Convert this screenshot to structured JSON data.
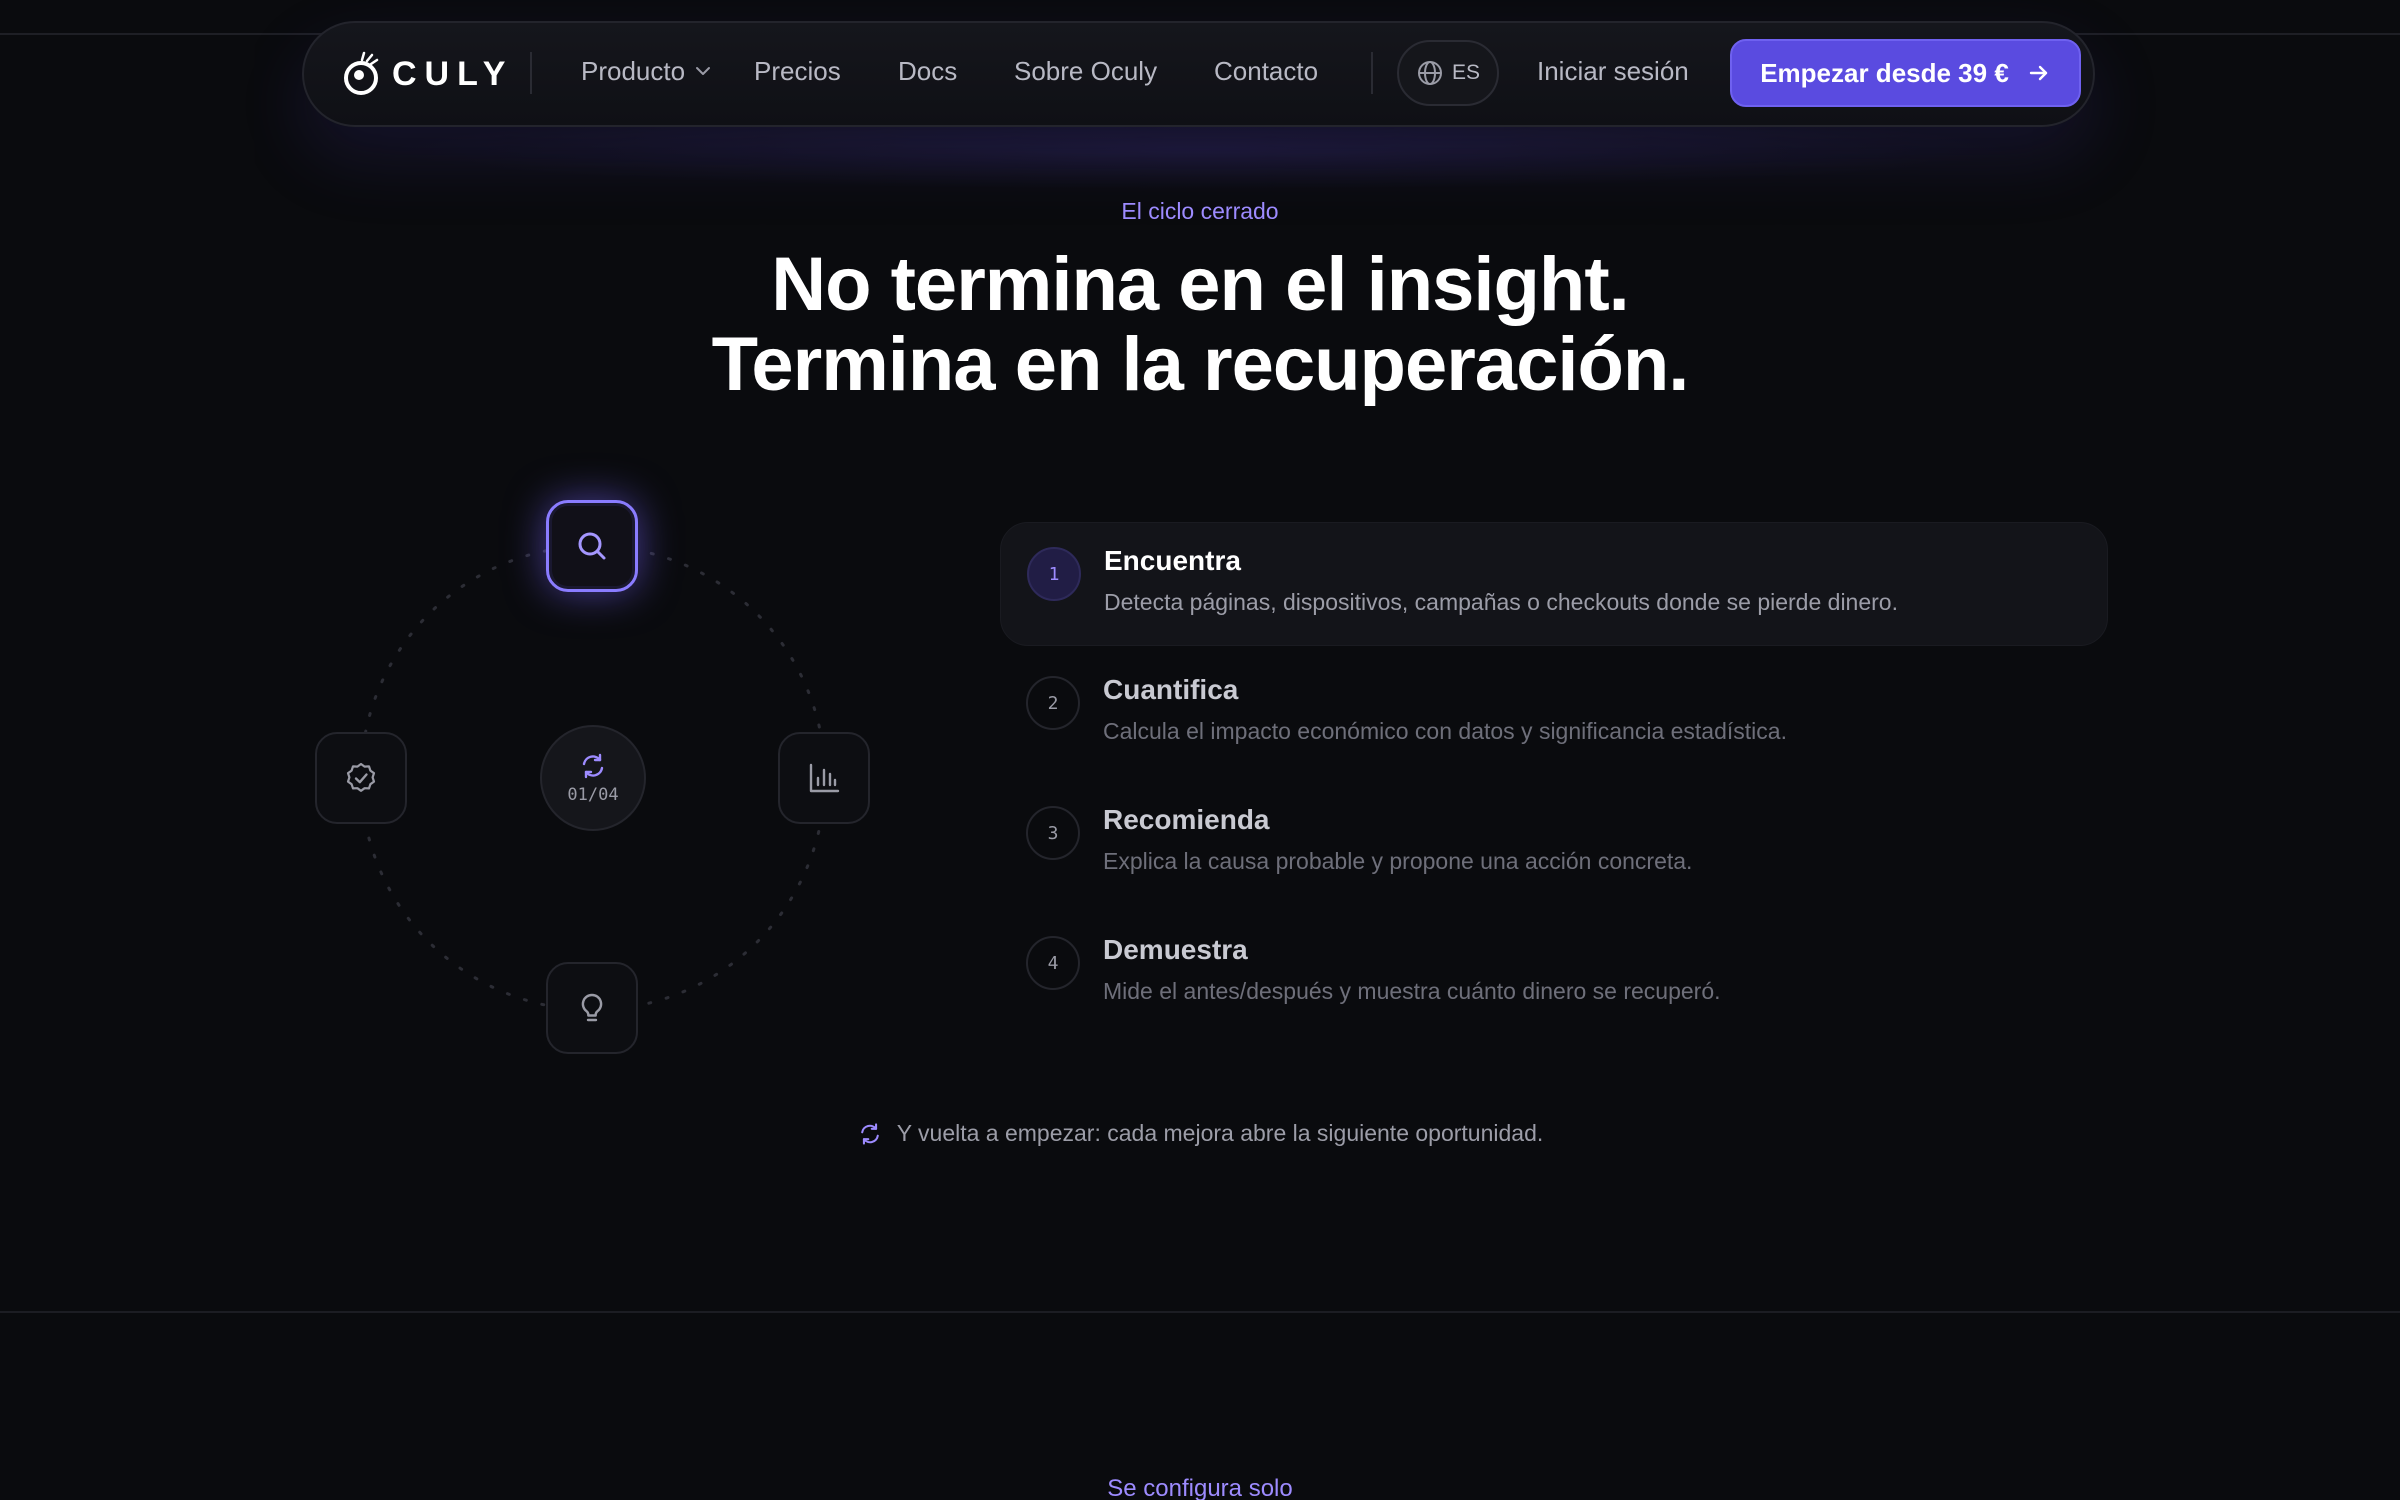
{
  "brand": {
    "name": "CULY"
  },
  "nav": {
    "links": [
      {
        "label": "Producto",
        "has_dropdown": true
      },
      {
        "label": "Precios"
      },
      {
        "label": "Docs"
      },
      {
        "label": "Sobre Oculy"
      },
      {
        "label": "Contacto"
      }
    ],
    "language": "ES",
    "login": "Iniciar sesión",
    "cta": "Empezar desde 39 €"
  },
  "hero": {
    "eyebrow": "El ciclo cerrado",
    "title_line1": "No termina en el insight.",
    "title_line2": "Termina en la recuperación."
  },
  "cycle": {
    "counter": "01/04",
    "nodes": [
      {
        "icon": "search-icon",
        "active": true
      },
      {
        "icon": "bar-chart-icon",
        "active": false
      },
      {
        "icon": "lightbulb-icon",
        "active": false
      },
      {
        "icon": "badge-check-icon",
        "active": false
      }
    ]
  },
  "steps": [
    {
      "num": "1",
      "title": "Encuentra",
      "desc": "Detecta páginas, dispositivos, campañas o checkouts donde se pierde dinero.",
      "active": true
    },
    {
      "num": "2",
      "title": "Cuantifica",
      "desc": "Calcula el impacto económico con datos y significancia estadística.",
      "active": false
    },
    {
      "num": "3",
      "title": "Recomienda",
      "desc": "Explica la causa probable y propone una acción concreta.",
      "active": false
    },
    {
      "num": "4",
      "title": "Demuestra",
      "desc": "Mide el antes/después y muestra cuánto dinero se recuperó.",
      "active": false
    }
  ],
  "footnote": "Y vuelta a empezar: cada mejora abre la siguiente oportunidad.",
  "next_section": {
    "eyebrow": "Se configura solo"
  },
  "colors": {
    "accent": "#5a4be0",
    "accent_light": "#9d8bff",
    "background": "#0a0b0e"
  }
}
